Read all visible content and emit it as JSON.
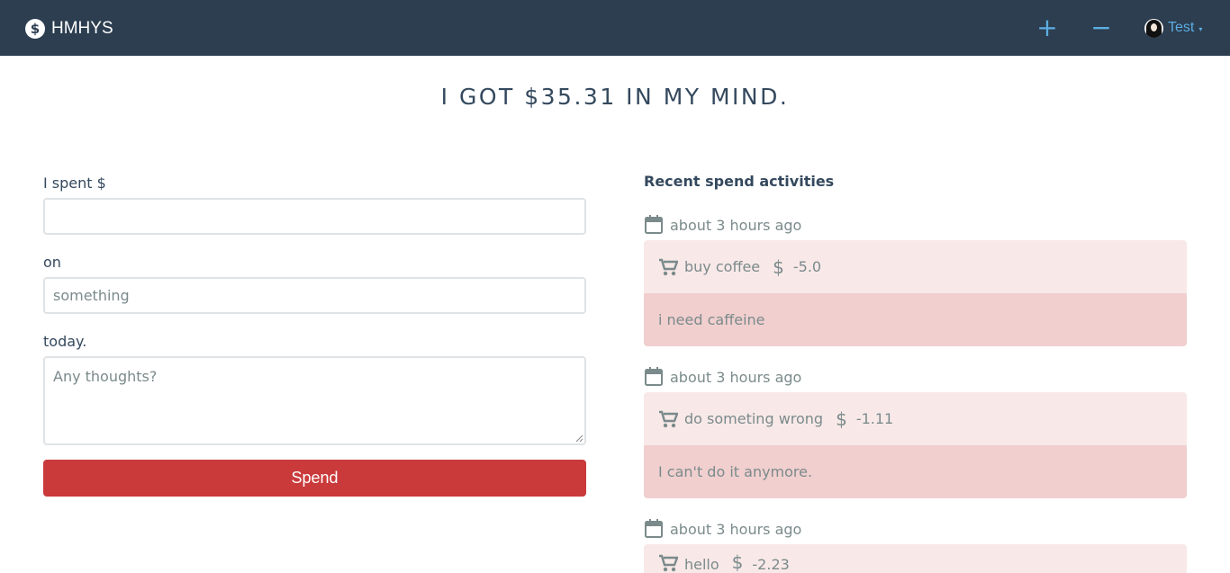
{
  "navbar": {
    "brand_icon": "$",
    "brand_name": "HMHYS",
    "add_label": "+",
    "subtract_label": "−",
    "user_name": "Test",
    "caret": "▾",
    "bg_color": "#2c3e50",
    "accent_color": "#5dade2"
  },
  "headline": "I GOT $35.31 IN MY MIND.",
  "form": {
    "amount_label": "I spent $",
    "amount_value": "",
    "on_label": "on",
    "on_placeholder": "something",
    "today_label": "today.",
    "thoughts_placeholder": "Any thoughts?",
    "submit_label": "Spend",
    "submit_color": "#ca3a3b"
  },
  "activities": {
    "title": "Recent spend activities",
    "items": [
      {
        "time": "about 3 hours ago",
        "item": "buy coffee",
        "amount": "-5.0",
        "note": "i need caffeine"
      },
      {
        "time": "about 3 hours ago",
        "item": "do someting wrong",
        "amount": "-1.11",
        "note": "I can't do it anymore."
      },
      {
        "time": "about 3 hours ago",
        "item": "hello",
        "amount": "-2.23",
        "note": ""
      }
    ],
    "icons": [
      "calendar-icon",
      "cart-icon",
      "dollar-icon"
    ]
  }
}
